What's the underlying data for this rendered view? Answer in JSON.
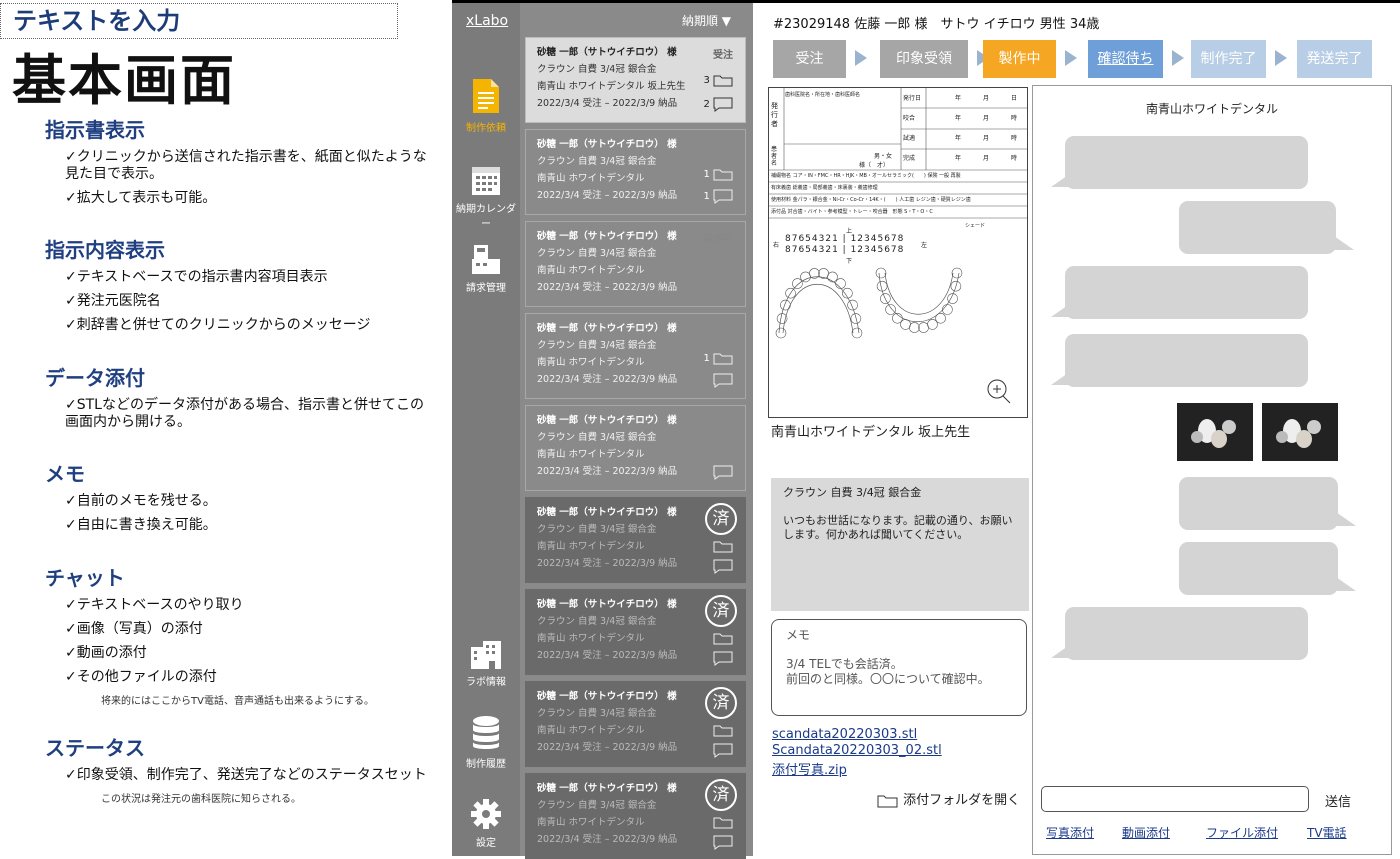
{
  "annotation": {
    "text_input": "テキストを入力",
    "title": "基本画面",
    "sections": [
      {
        "heading": "指示書表示",
        "items": [
          "✓クリニックから送信された指示書を、紙面と似たような見た目で表示。",
          "✓拡大して表示も可能。"
        ],
        "note": ""
      },
      {
        "heading": "指示内容表示",
        "items": [
          "✓テキストベースでの指示書内容項目表示",
          "✓発注元医院名",
          "✓刺辞書と併せてのクリニックからのメッセージ"
        ],
        "note": ""
      },
      {
        "heading": "データ添付",
        "items": [
          "✓STLなどのデータ添付がある場合、指示書と併せてこの画面内から開ける。"
        ],
        "note": ""
      },
      {
        "heading": "メモ",
        "items": [
          "✓自前のメモを残せる。",
          "✓自由に書き換え可能。"
        ],
        "note": ""
      },
      {
        "heading": "チャット",
        "items": [
          "✓テキストベースのやり取り",
          "✓画像（写真）の添付",
          "✓動画の添付",
          "✓その他ファイルの添付"
        ],
        "note": "将来的にはここからTV電話、音声通話も出来るようにする。"
      },
      {
        "heading": "ステータス",
        "items": [
          "✓印象受領、制作完了、発送完了などのステータスセット"
        ],
        "note": "この状況は発注元の歯科医院に知らされる。"
      }
    ]
  },
  "sidebar": {
    "logo": "xLabo",
    "items": [
      {
        "label": "制作依頼",
        "icon": "document-icon",
        "accent": "#f5b400"
      },
      {
        "label": "納期カレンダー",
        "icon": "calendar-icon"
      },
      {
        "label": "請求管理",
        "icon": "register-icon"
      },
      {
        "label": "ラボ情報",
        "icon": "building-icon"
      },
      {
        "label": "制作履歴",
        "icon": "database-icon"
      },
      {
        "label": "設定",
        "icon": "gear-icon"
      }
    ]
  },
  "order_list": {
    "sort_label": "納期順 ▼",
    "cards": [
      {
        "name": "砂糖 一郎（サトウイチロウ） 様",
        "product": "クラウン 自費 3/4冠 銀合金",
        "clinic": "南青山 ホワイトデンタル 坂上先生",
        "dates": "2022/3/4 受注 – 2022/3/9 納品",
        "status": "受注",
        "files": "3",
        "msgs": "2",
        "state": "selected"
      },
      {
        "name": "砂糖 一郎（サトウイチロウ） 様",
        "product": "クラウン 自費 3/4冠 銀合金",
        "clinic": "南青山 ホワイトデンタル",
        "dates": "2022/3/4 受注 – 2022/3/9 納品",
        "status": "",
        "files": "1",
        "msgs": "1",
        "state": "normal"
      },
      {
        "name": "砂糖 一郎（サトウイチロウ） 様",
        "product": "クラウン 自費 3/4冠 銀合金",
        "clinic": "南青山 ホワイトデンタル",
        "dates": "2022/3/4 受注 – 2022/3/9 納品",
        "status": "製作中",
        "files": "",
        "msgs": "",
        "state": "normal"
      },
      {
        "name": "砂糖 一郎（サトウイチロウ） 様",
        "product": "クラウン 自費 3/4冠 銀合金",
        "clinic": "南青山 ホワイトデンタル",
        "dates": "2022/3/4 受注 – 2022/3/9 納品",
        "status": "",
        "files": "1",
        "msgs": "",
        "state": "normal"
      },
      {
        "name": "砂糖 一郎（サトウイチロウ） 様",
        "product": "クラウン 自費 3/4冠 銀合金",
        "clinic": "南青山 ホワイトデンタル",
        "dates": "2022/3/4 受注 – 2022/3/9 納品",
        "status": "",
        "files": "",
        "msgs": "",
        "state": "normal"
      },
      {
        "name": "砂糖 一郎（サトウイチロウ） 様",
        "product": "クラウン 自費 3/4冠 銀合金",
        "clinic": "南青山 ホワイトデンタル",
        "dates": "2022/3/4 受注 – 2022/3/9 納品",
        "status": "済",
        "files": "",
        "msgs": "",
        "state": "done"
      },
      {
        "name": "砂糖 一郎（サトウイチロウ） 様",
        "product": "クラウン 自費 3/4冠 銀合金",
        "clinic": "南青山 ホワイトデンタル",
        "dates": "2022/3/4 受注 – 2022/3/9 納品",
        "status": "済",
        "files": "",
        "msgs": "",
        "state": "done"
      },
      {
        "name": "砂糖 一郎（サトウイチロウ） 様",
        "product": "クラウン 自費 3/4冠 銀合金",
        "clinic": "南青山 ホワイトデンタル",
        "dates": "2022/3/4 受注 – 2022/3/9 納品",
        "status": "済",
        "files": "",
        "msgs": "",
        "state": "done"
      },
      {
        "name": "砂糖 一郎（サトウイチロウ） 様",
        "product": "クラウン 自費 3/4冠 銀合金",
        "clinic": "南青山 ホワイトデンタル",
        "dates": "2022/3/4 受注 – 2022/3/9 納品",
        "status": "済",
        "files": "",
        "msgs": "",
        "state": "done"
      }
    ]
  },
  "detail": {
    "patient_header": "#23029148 佐藤 一郎 様　サトウ イチロウ 男性 34歳",
    "steps": [
      {
        "label": "受注",
        "color": "#a6a6a6"
      },
      {
        "label": "印象受領",
        "color": "#a6a6a6"
      },
      {
        "label": "製作中",
        "color": "#f5a623"
      },
      {
        "label": "確認待ち",
        "color": "#6f9fd8"
      },
      {
        "label": "制作完了",
        "color": "#b8cde6"
      },
      {
        "label": "発送完了",
        "color": "#b8cde6"
      }
    ],
    "sheet": {
      "issuer_label": "発行者",
      "clinic_label": "歯科医院名・所在地・歯科医師名",
      "patient_label": "患者名",
      "sex_label": "男・女",
      "age_label": "様（　才）",
      "rows": [
        [
          "発行日",
          "年",
          "月",
          "日"
        ],
        [
          "咬合",
          "年",
          "月",
          "時"
        ],
        [
          "試適",
          "年",
          "月",
          "時"
        ],
        [
          "完成",
          "年",
          "月",
          "時"
        ]
      ],
      "tech_line": "補綴物名 コア・IN・FMC・HR・HJK・MB・オールセラミック(　　) 保険 一般 再製",
      "denture_line": "有床義歯 総義歯・局部義歯・床裏装・義歯修理",
      "material_line": "使用材料 金パラ・銀合金・Ni-Cr・Co-Cr・14K・(　　) 人工歯 レジン歯・硬質レジン歯",
      "attach_line": "添付品 対合歯・バイト・参考模型・トレー・咬合器　形態 S・T・O・C",
      "shade_label": "シェード",
      "teeth_upper": "87654321 | 12345678",
      "teeth_lower": "87654321 | 12345678",
      "right_label": "右",
      "left_label": "左",
      "up_label": "上",
      "down_label": "下"
    },
    "clinic_doctor": "南青山ホワイトデンタル 坂上先生",
    "request_product": "クラウン 自費 3/4冠 銀合金",
    "request_message": "いつもお世話になります。記載の通り、お願いします。何かあれば聞いてください。",
    "memo_label": "メモ",
    "memo_text": "3/4 TELでも会話済。\n前回のと同様。〇〇について確認中。",
    "files": [
      "scandata20220303.stl",
      "Scandata20220303_02.stl",
      "添付写真.zip"
    ],
    "open_folder": "添付フォルダを開く"
  },
  "chat": {
    "title": "南青山ホワイトデンタル",
    "send": "送信",
    "actions": [
      "写真添付",
      "動画添付",
      "ファイル添付",
      "TV電話"
    ]
  }
}
